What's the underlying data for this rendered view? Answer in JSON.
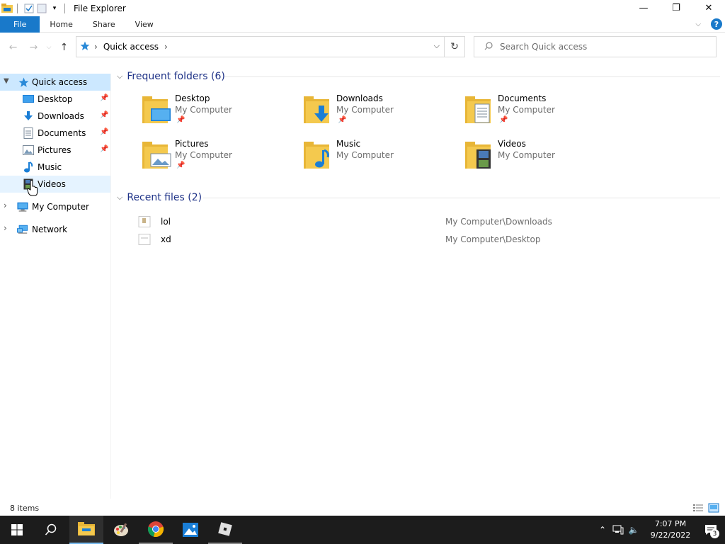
{
  "window": {
    "title": "File Explorer",
    "minimize": "—",
    "restore": "❐",
    "close": "✕"
  },
  "ribbon": {
    "tabs": [
      {
        "label": "File"
      },
      {
        "label": "Home"
      },
      {
        "label": "Share"
      },
      {
        "label": "View"
      }
    ]
  },
  "address": {
    "location": "Quick access",
    "search_placeholder": "Search Quick access"
  },
  "navpane": {
    "quick_access": "Quick access",
    "items": [
      {
        "label": "Desktop",
        "icon": "desktop-icon",
        "pinned": true
      },
      {
        "label": "Downloads",
        "icon": "downloads-icon",
        "pinned": true
      },
      {
        "label": "Documents",
        "icon": "documents-icon",
        "pinned": true
      },
      {
        "label": "Pictures",
        "icon": "pictures-icon",
        "pinned": true
      },
      {
        "label": "Music",
        "icon": "music-icon",
        "pinned": false
      },
      {
        "label": "Videos",
        "icon": "videos-icon",
        "pinned": false
      }
    ],
    "my_computer": "My Computer",
    "network": "Network"
  },
  "content": {
    "frequent_header": "Frequent folders (6)",
    "frequent": [
      {
        "name": "Desktop",
        "location": "My Computer",
        "pinned": true,
        "overlay": "desktop"
      },
      {
        "name": "Downloads",
        "location": "My Computer",
        "pinned": true,
        "overlay": "downloads"
      },
      {
        "name": "Documents",
        "location": "My Computer",
        "pinned": true,
        "overlay": "documents"
      },
      {
        "name": "Pictures",
        "location": "My Computer",
        "pinned": true,
        "overlay": "pictures"
      },
      {
        "name": "Music",
        "location": "My Computer",
        "pinned": false,
        "overlay": "music"
      },
      {
        "name": "Videos",
        "location": "My Computer",
        "pinned": false,
        "overlay": "videos"
      }
    ],
    "recent_header": "Recent files (2)",
    "recent": [
      {
        "name": "lol",
        "path": "My Computer\\Downloads"
      },
      {
        "name": "xd",
        "path": "My Computer\\Desktop"
      }
    ]
  },
  "status": {
    "item_count": "8 items"
  },
  "taskbar": {
    "time": "7:07 PM",
    "date": "9/22/2022",
    "notifications": "3"
  },
  "colors": {
    "accent": "#1979ca",
    "selected": "#cce8ff",
    "header_text": "#1e3287",
    "folder": "#f4c94e",
    "taskbar": "#1c1c1c"
  }
}
